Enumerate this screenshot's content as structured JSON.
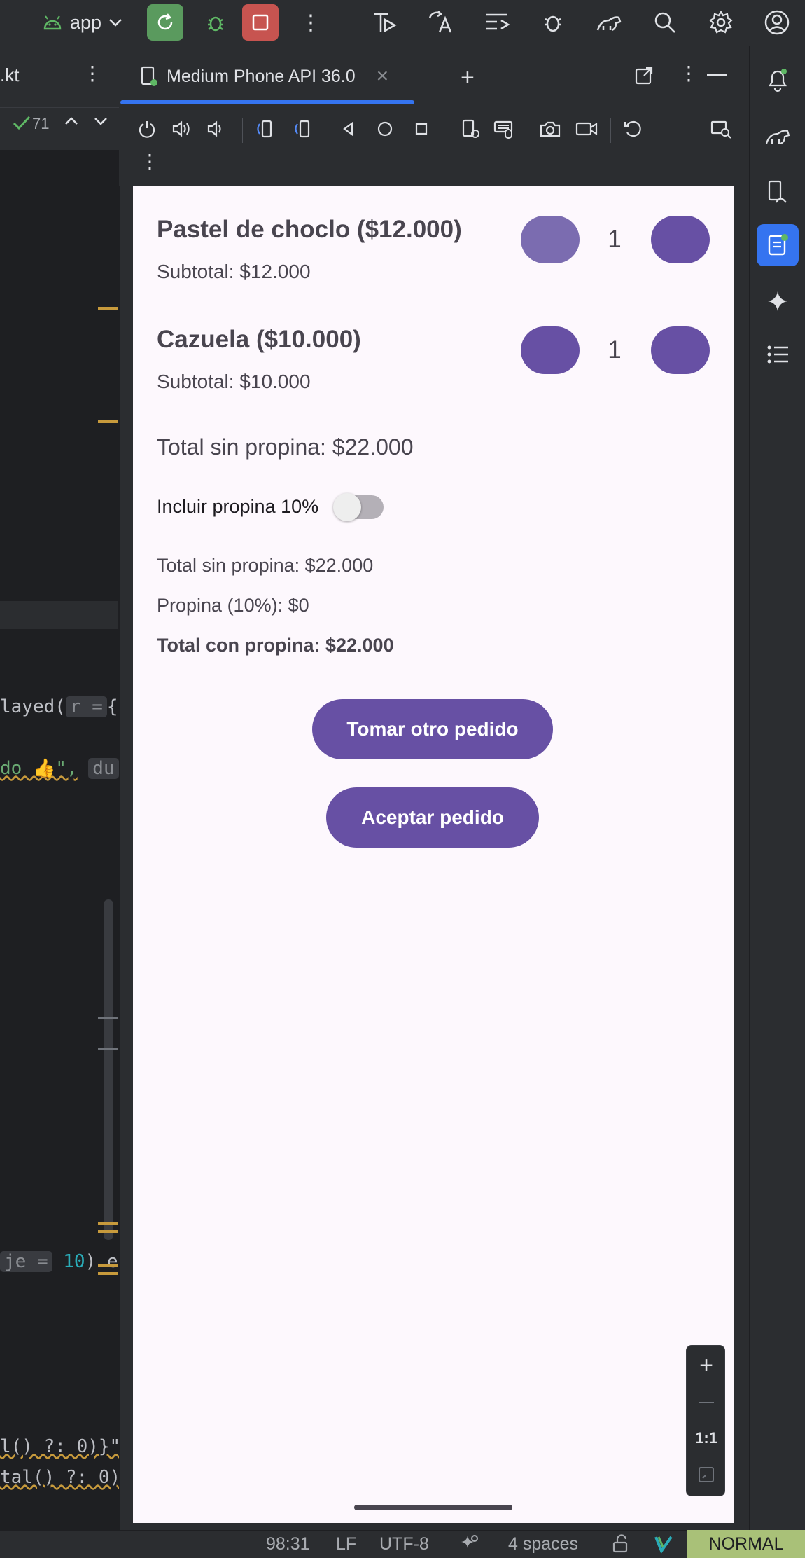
{
  "toolbar": {
    "app_label": "app",
    "more_label": "⋮"
  },
  "editor": {
    "tab_label": ".kt",
    "check_count": "71",
    "code_lines": {
      "line1": "layed(",
      "line1_hint": "r =",
      "line1_tail": "{",
      "line2": "do 👍\",",
      "line2_hint": "du",
      "line3_hint": "je =",
      "line3_num": "10",
      "line3_tail": ") els",
      "line4": "l() ?: 0)}\"",
      "line5": "tal() ?: 0)"
    }
  },
  "device_panel": {
    "tab_title": "Medium Phone API 36.0",
    "close_label": "×",
    "add_label": "+"
  },
  "app_screen": {
    "items": [
      {
        "name": "Pastel de choclo ($12.000)",
        "subtotal": "Subtotal: $12.000",
        "qty": "1"
      },
      {
        "name": "Cazuela ($10.000)",
        "subtotal": "Subtotal: $10.000",
        "qty": "1"
      }
    ],
    "total_sin_propina_header": "Total sin propina: $22.000",
    "tip_toggle_label": "Incluir propina 10%",
    "tip_enabled": false,
    "summary": {
      "total_sin_propina": "Total sin propina: $22.000",
      "propina": "Propina (10%): $0",
      "total_con_propina": "Total con propina: $22.000"
    },
    "buttons": {
      "new_order": "Tomar otro pedido",
      "accept_order": "Aceptar pedido"
    }
  },
  "zoom_controls": {
    "zoom_in": "+",
    "zoom_out": "—",
    "actual_size": "1:1"
  },
  "status_bar": {
    "position": "98:31",
    "line_ending": "LF",
    "encoding": "UTF-8",
    "indent": "4 spaces",
    "vim_mode": "NORMAL"
  },
  "colors": {
    "accent": "#6750a4",
    "ide_bg": "#1e1f22",
    "panel_bg": "#2b2d30",
    "run_green": "#5a9a5e",
    "stop_red": "#c75450",
    "selection_blue": "#3574f0",
    "vim_mode_bg": "#a9c178"
  }
}
